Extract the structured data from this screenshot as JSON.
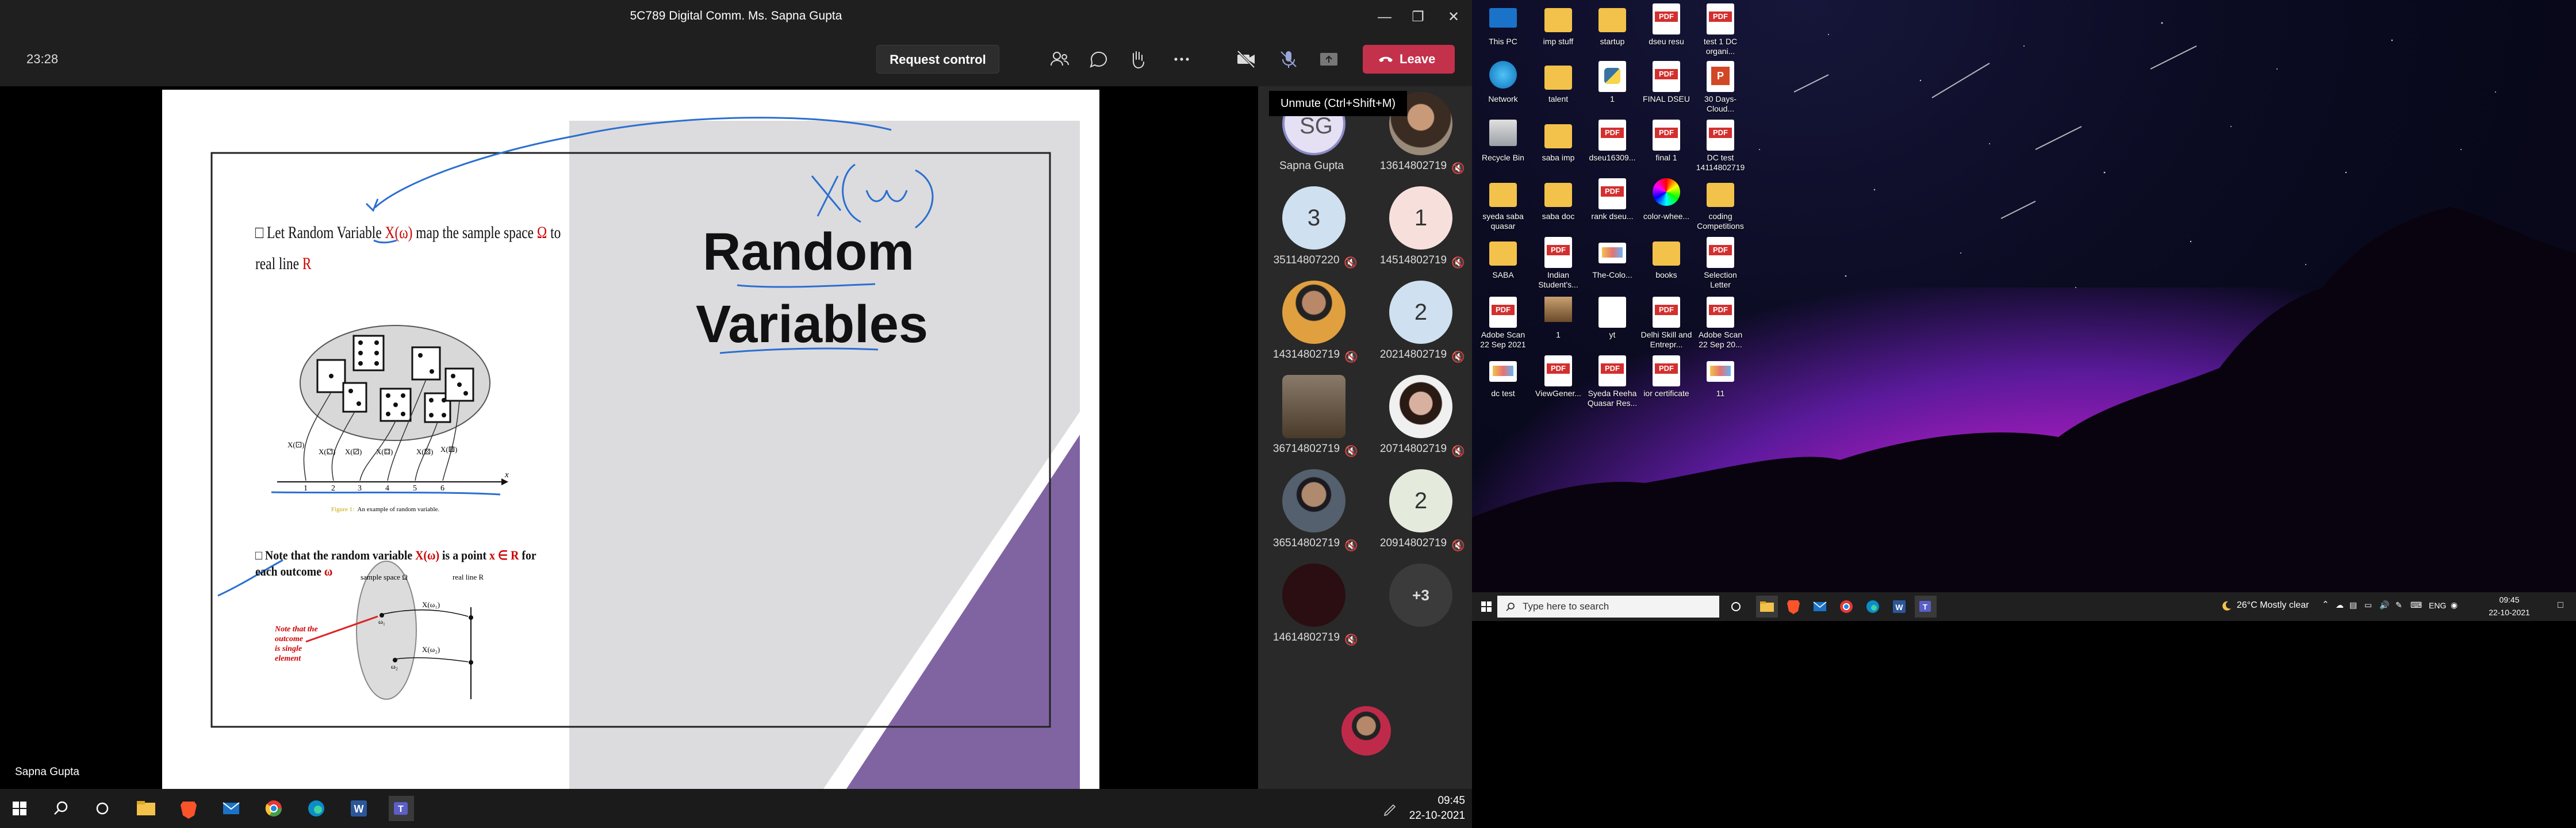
{
  "window": {
    "title": "5C789 Digital Comm. Ms. Sapna Gupta",
    "time": "23:28"
  },
  "toolbar": {
    "request_control": "Request control",
    "leave": "Leave",
    "icons": [
      "people-icon",
      "chat-icon",
      "raise-hand-icon",
      "more-icon",
      "camera-off-icon",
      "mic-off-icon",
      "share-icon"
    ],
    "tooltip": "Unmute (Ctrl+Shift+M)"
  },
  "slide": {
    "title_line1": "Random",
    "title_line2": "Variables",
    "bullet1_prefix": "Let Random Variable ",
    "bullet1_var": "X(ω)",
    "bullet1_mid": " map the sample space ",
    "bullet1_omega": "Ω",
    "bullet1_end": " to",
    "bullet1_line2": "real line ",
    "bullet1_R": "R",
    "fig_caption_label": "Figure 1:",
    "fig_caption": "An example of random variable.",
    "axis_ticks": [
      "1",
      "2",
      "3",
      "4",
      "5",
      "6"
    ],
    "axis_x": "x",
    "bullet2_prefix": "Note that the random variable ",
    "bullet2_var": "X(ω)",
    "bullet2_mid": " is a point ",
    "bullet2_math": "x ∈ R",
    "bullet2_end": " for",
    "bullet2_line2": "each outcome ",
    "bullet2_omega": "ω",
    "fig2_label_space": "sample space Ω",
    "fig2_label_line": "real line R",
    "fig2_note": [
      "Note that the",
      "outcome",
      "is single",
      "element"
    ],
    "xw1": "X(ω₁)",
    "xw2": "X(ω₂)",
    "w1": "ω₁",
    "w2": "ω₂",
    "dice_labels": [
      "X(⚀)",
      "X(⚁)",
      "X(⚂)",
      "X(⚃)",
      "X(⚄)",
      "X(⚅)"
    ]
  },
  "presenter": "Sapna Gupta",
  "participants": [
    {
      "name": "Sapna Gupta",
      "initials": "SG",
      "type": "initials",
      "bg": "#e6e0f5",
      "fg": "#444"
    },
    {
      "name": "13614802719",
      "type": "photo",
      "bg": "#7a6a5a"
    },
    {
      "name": "35114807220",
      "initials": "3",
      "type": "initials",
      "bg": "#cfe0f0",
      "fg": "#333"
    },
    {
      "name": "14514802719",
      "initials": "1",
      "type": "initials",
      "bg": "#f7e0dc",
      "fg": "#333"
    },
    {
      "name": "14314802719",
      "type": "photo",
      "bg": "#c98a3a"
    },
    {
      "name": "20214802719",
      "initials": "2",
      "type": "initials",
      "bg": "#cfe0f0",
      "fg": "#333"
    },
    {
      "name": "36714802719",
      "type": "photo",
      "bg": "#6b5a4a"
    },
    {
      "name": "20714802719",
      "type": "photo",
      "bg": "#d8c8c0"
    },
    {
      "name": "36514802719",
      "type": "photo",
      "bg": "#4a5260"
    },
    {
      "name": "20914802719",
      "initials": "2",
      "type": "initials",
      "bg": "#e4eadc",
      "fg": "#333"
    },
    {
      "name": "14614802719",
      "type": "photo",
      "bg": "#2a0e12"
    },
    {
      "name": "",
      "initials": "+3",
      "type": "initials",
      "bg": "#3b3b3b",
      "fg": "#ddd"
    }
  ],
  "taskbar1": {
    "time": "09:45",
    "date": "22-10-2021"
  },
  "desktop": {
    "icons": [
      {
        "label": "This PC",
        "kind": "pc"
      },
      {
        "label": "imp stuff",
        "kind": "folder"
      },
      {
        "label": "startup",
        "kind": "folder"
      },
      {
        "label": "dseu resu",
        "kind": "pdf"
      },
      {
        "label": "test 1 DC organi...",
        "kind": "pdf"
      },
      {
        "label": "Network",
        "kind": "network"
      },
      {
        "label": "talent",
        "kind": "folder"
      },
      {
        "label": "1",
        "kind": "python"
      },
      {
        "label": "FINAL DSEU",
        "kind": "pdf"
      },
      {
        "label": "30 Days-Cloud...",
        "kind": "ppt"
      },
      {
        "label": "Recycle Bin",
        "kind": "bin"
      },
      {
        "label": "saba imp",
        "kind": "folder"
      },
      {
        "label": "dseu16309...",
        "kind": "pdf"
      },
      {
        "label": "final 1",
        "kind": "pdf"
      },
      {
        "label": "DC test 14114802719",
        "kind": "pdf"
      },
      {
        "label": "syeda saba quasar",
        "kind": "folder"
      },
      {
        "label": "saba doc",
        "kind": "folder"
      },
      {
        "label": "rank dseu...",
        "kind": "pdf"
      },
      {
        "label": "color-whee...",
        "kind": "wheel"
      },
      {
        "label": "coding Competitions",
        "kind": "folder"
      },
      {
        "label": "SABA",
        "kind": "folder"
      },
      {
        "label": "Indian Student's...",
        "kind": "pdf"
      },
      {
        "label": "The-Colo...",
        "kind": "image"
      },
      {
        "label": "books",
        "kind": "folder"
      },
      {
        "label": "Selection Letter",
        "kind": "pdf"
      },
      {
        "label": "Adobe Scan 22 Sep 2021",
        "kind": "pdf"
      },
      {
        "label": "1",
        "kind": "photo"
      },
      {
        "label": "yt",
        "kind": "doc"
      },
      {
        "label": "Delhi Skill and Entrepr...",
        "kind": "pdf"
      },
      {
        "label": "Adobe Scan 22 Sep 20...",
        "kind": "pdf"
      },
      {
        "label": "dc test",
        "kind": "image"
      },
      {
        "label": "ViewGener...",
        "kind": "pdf"
      },
      {
        "label": "Syeda Reeha Quasar Res...",
        "kind": "pdf"
      },
      {
        "label": "ior certificate",
        "kind": "pdf"
      },
      {
        "label": "11",
        "kind": "image"
      }
    ],
    "search_placeholder": "Type here to search",
    "weather": "26°C  Mostly clear",
    "lang": "ENG",
    "time": "09:45",
    "date": "22-10-2021"
  },
  "colors": {
    "accent_leave": "#c4314b",
    "slide_purple": "#8064a2",
    "ink_blue": "#2b6fd0"
  }
}
